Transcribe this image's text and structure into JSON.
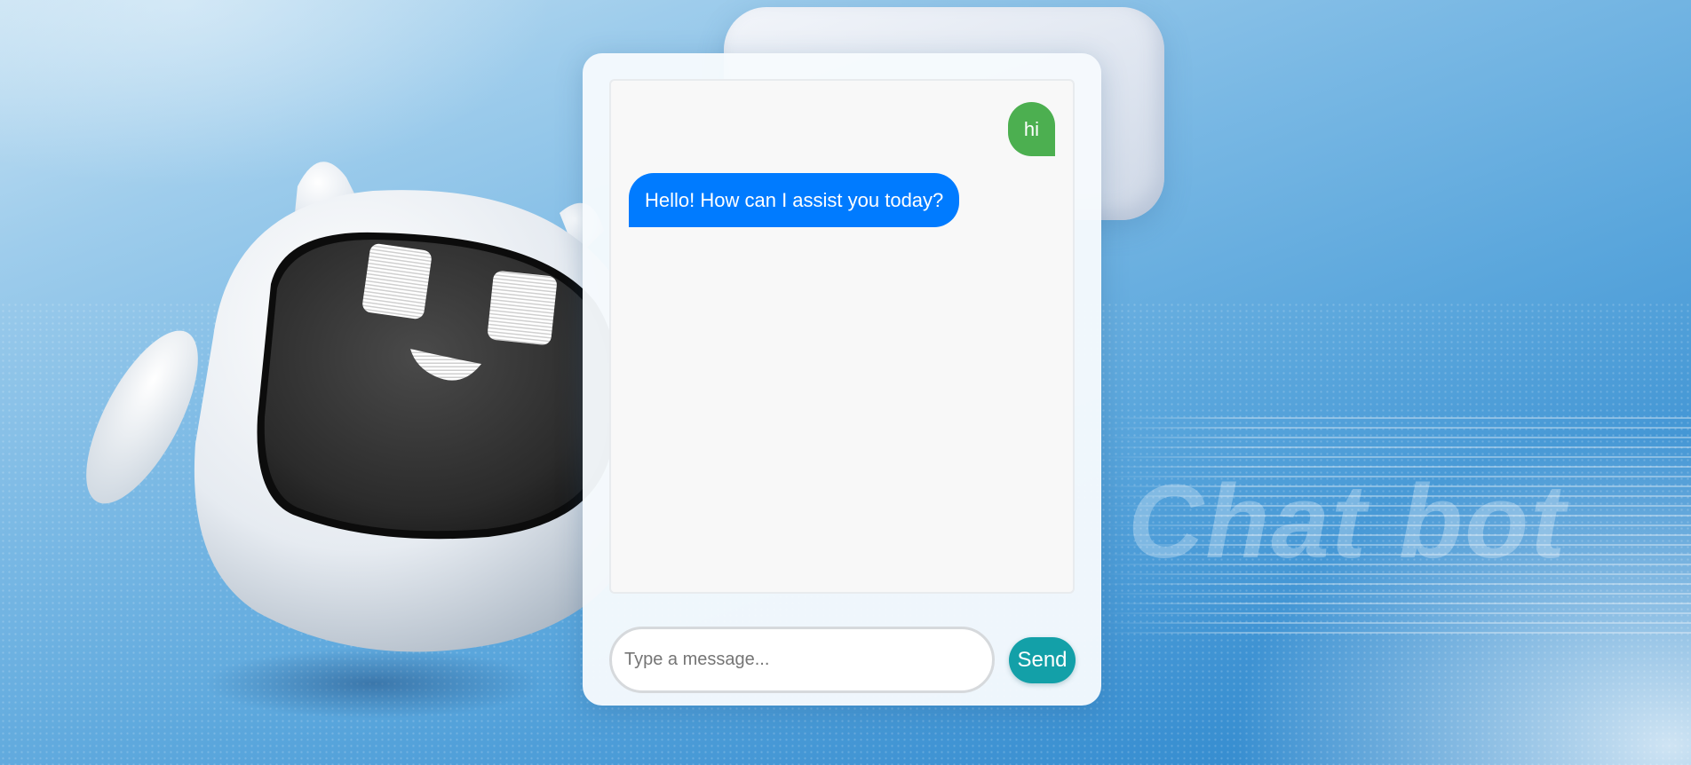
{
  "background": {
    "watermark_text": "Chat bot"
  },
  "chat": {
    "messages": [
      {
        "sender": "user",
        "text": "hi"
      },
      {
        "sender": "bot",
        "text": "Hello! How can I assist you today?"
      }
    ],
    "input": {
      "value": "",
      "placeholder": "Type a message..."
    },
    "send_label": "Send"
  },
  "colors": {
    "user_bubble": "#4caf50",
    "bot_bubble": "#007bff",
    "send_button": "#13a0a8"
  },
  "icons": {
    "robot_mascot": "robot-mascot-illustration"
  }
}
